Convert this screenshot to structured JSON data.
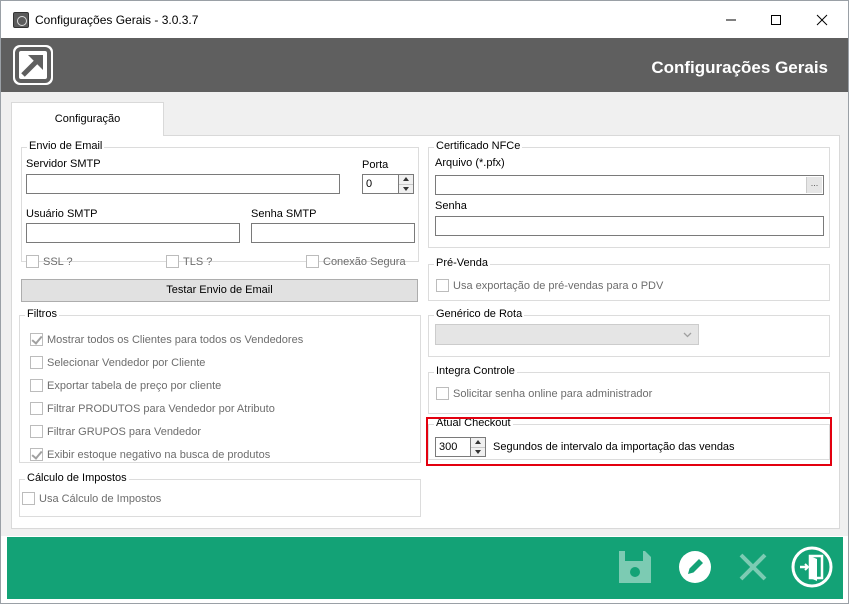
{
  "window": {
    "title": "Configurações Gerais - 3.0.3.7"
  },
  "header": {
    "title": "Configurações Gerais"
  },
  "tabs": [
    {
      "label": "Configuração"
    }
  ],
  "email": {
    "legend": "Envio de Email",
    "smtp_server_label": "Servidor SMTP",
    "smtp_server_value": "",
    "port_label": "Porta",
    "port_value": "0",
    "smtp_user_label": "Usuário SMTP",
    "smtp_user_value": "",
    "smtp_password_label": "Senha SMTP",
    "smtp_password_value": "",
    "ssl_label": "SSL ?",
    "tls_label": "TLS ?",
    "secure_label": "Conexão Segura",
    "test_button": "Testar Envio de Email"
  },
  "filters": {
    "legend": "Filtros",
    "items": [
      {
        "label": "Mostrar todos os Clientes para todos os Vendedores",
        "checked": true
      },
      {
        "label": "Selecionar Vendedor por Cliente",
        "checked": false
      },
      {
        "label": "Exportar tabela de preço por cliente",
        "checked": false
      },
      {
        "label": "Filtrar PRODUTOS para Vendedor por Atributo",
        "checked": false
      },
      {
        "label": "Filtrar GRUPOS para Vendedor",
        "checked": false
      },
      {
        "label": "Exibir estoque negativo na busca de produtos",
        "checked": true
      }
    ]
  },
  "taxes": {
    "legend": "Cálculo de Impostos",
    "use_label": "Usa Cálculo de Impostos"
  },
  "nfce": {
    "legend": "Certificado NFCe",
    "file_label": "Arquivo (*.pfx)",
    "file_value": "",
    "browse_label": "...",
    "password_label": "Senha",
    "password_value": ""
  },
  "presale": {
    "legend": "Pré-Venda",
    "export_label": "Usa exportação de pré-vendas para o PDV"
  },
  "route": {
    "legend": "Genérico de Rota",
    "selected": ""
  },
  "integra": {
    "legend": "Integra Controle",
    "online_password_label": "Solicitar senha online para administrador"
  },
  "checkout": {
    "legend": "Atual Checkout",
    "interval_value": "300",
    "interval_label": "Segundos de intervalo da importação das vendas"
  },
  "colors": {
    "header_bg": "#5f5f5f",
    "footer_bg": "#13a276",
    "highlight": "#e3000f"
  },
  "footer_icons": [
    "save-icon",
    "edit-icon",
    "cancel-icon",
    "exit-icon"
  ]
}
